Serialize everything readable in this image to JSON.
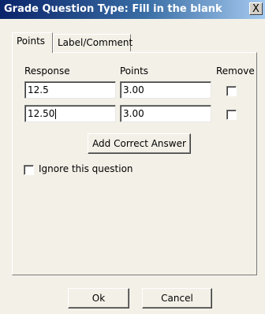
{
  "window": {
    "title": "Grade Question Type: Fill in the blank",
    "close_label": "X"
  },
  "tabs": [
    {
      "label": "Points",
      "active": true
    },
    {
      "label": "Label/Comment",
      "active": false
    }
  ],
  "table": {
    "headers": {
      "response": "Response",
      "points": "Points",
      "remove": "Remove"
    },
    "rows": [
      {
        "response": "12.5",
        "points": "3.00",
        "remove": false
      },
      {
        "response": "12.50",
        "points": "3.00",
        "remove": false
      }
    ]
  },
  "add_correct_answer_label": "Add Correct Answer",
  "ignore_question": {
    "label": "Ignore this question",
    "checked": false
  },
  "buttons": {
    "ok": "Ok",
    "cancel": "Cancel"
  }
}
